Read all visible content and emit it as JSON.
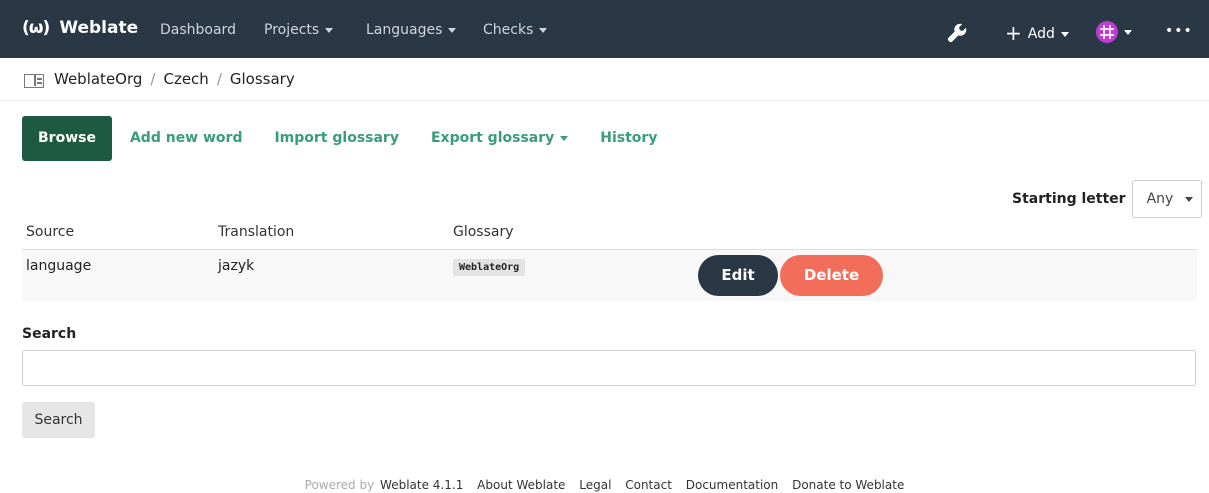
{
  "navbar": {
    "logo": "(ω)",
    "brand": "Weblate",
    "items": [
      "Dashboard",
      "Projects",
      "Languages",
      "Checks"
    ],
    "add_label": "Add",
    "more": "•••",
    "bg_color": "#2a3744"
  },
  "breadcrumb": [
    "WeblateOrg",
    "Czech",
    "Glossary"
  ],
  "tabs": [
    "Browse",
    "Add new word",
    "Import glossary",
    "Export glossary",
    "History"
  ],
  "filter": {
    "label": "Starting letter",
    "value": "Any"
  },
  "table": {
    "headers": [
      "Source",
      "Translation",
      "Glossary"
    ],
    "rows": [
      {
        "source": "language",
        "translation": "jazyk",
        "glossary": "WeblateOrg"
      }
    ],
    "edit_label": "Edit",
    "delete_label": "Delete"
  },
  "search": {
    "label": "Search",
    "value": "",
    "button": "Search"
  },
  "footer": {
    "powered": "Powered by",
    "version": "Weblate 4.1.1",
    "links": [
      "About Weblate",
      "Legal",
      "Contact",
      "Documentation",
      "Donate to Weblate"
    ]
  },
  "colors": {
    "accent": "#3a9c7c",
    "active_tab": "#1e5a42",
    "delete": "#f26e5b",
    "edit": "#2a3744"
  }
}
